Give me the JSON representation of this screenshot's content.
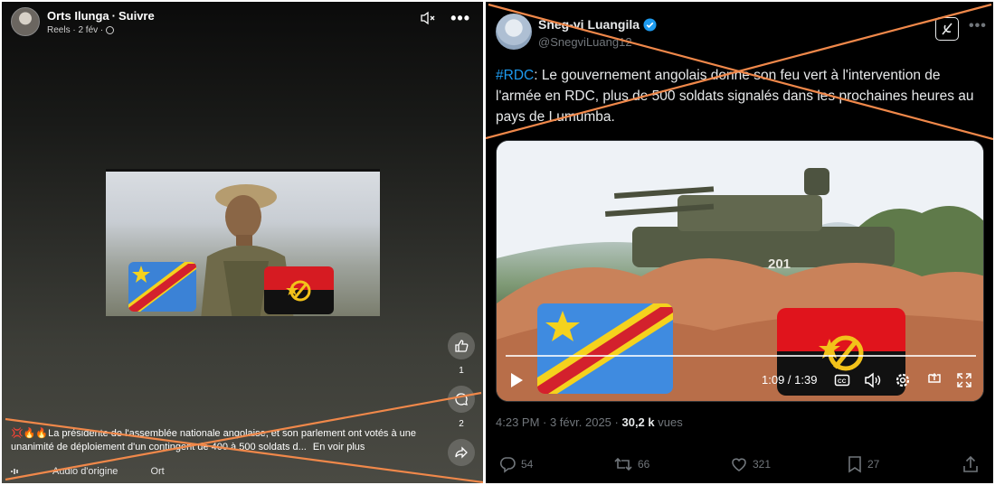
{
  "facebook": {
    "author": "Orts Ilunga",
    "separator": "·",
    "follow": "Suivre",
    "subline": "Reels · 2 fév ·",
    "like_count": "1",
    "comment_count": "2",
    "caption": "💢🔥🔥La présidente de l'assemblée nationale angolaise, et son parlement ont votés à une unanimité de déploiement d'un contingent  de 400 à 500 soldats d...",
    "see_more": "En voir plus",
    "audio_label": "Audio d'origine",
    "audio_author": "Ort",
    "icons": [
      "avatar",
      "globe-icon",
      "mute-icon",
      "more-icon",
      "like-icon",
      "comment-icon",
      "share-icon",
      "audio-icon"
    ]
  },
  "x_post": {
    "display_name": "Sneg-vi Luangila",
    "handle": "@SnegviLuang12",
    "hashtag": "#RDC",
    "text": ": Le gouvernement angolais donne son feu vert à l'intervention de l'armée en RDC, plus de 500 soldats signalés dans les prochaines heures au pays de Lumumba.",
    "video_overlay_number": "201",
    "video_time": "1:09 / 1:39",
    "timestamp": "4:23 PM · 3 févr. 2025 ·",
    "views": "30,2 k",
    "views_label": "vues",
    "replies": "54",
    "reposts": "66",
    "likes": "321",
    "bookmarks": "27",
    "icons": [
      "verified-icon",
      "grok-icon",
      "more-icon",
      "play-icon",
      "captions-icon",
      "volume-icon",
      "settings-icon",
      "pip-icon",
      "fullscreen-icon",
      "reply-icon",
      "repost-icon",
      "like-icon",
      "bookmark-icon",
      "share-icon"
    ]
  },
  "colors": {
    "cross_mark": "#f0884a",
    "x_link": "#1d9bf0",
    "x_secondary": "#71767b",
    "x_primary_text": "#e7e9ea"
  }
}
